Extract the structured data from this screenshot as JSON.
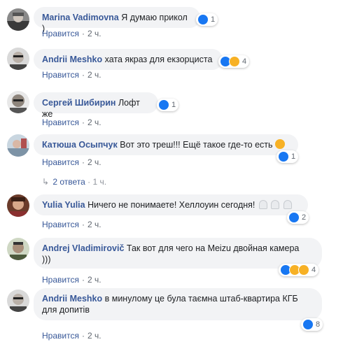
{
  "labels": {
    "like_action": "Нравится",
    "separator": "·"
  },
  "colors": {
    "author": "#385898",
    "bubble": "#f2f3f5",
    "like_reaction": "#1877f2",
    "haha_reaction": "#f7b125"
  },
  "comments": [
    {
      "author": "Marina Vadimovna",
      "text": "Я думаю прикол )",
      "text2": "",
      "reactions": [
        "like"
      ],
      "count": "1",
      "time": "2 ч."
    },
    {
      "author": "Andrii Meshko",
      "text": "хата якраз для екзорциста",
      "text2": "",
      "reactions": [
        "like",
        "haha"
      ],
      "count": "4",
      "time": "2 ч."
    },
    {
      "author": "Сергей Шибирин",
      "text": "Лофт же",
      "text2": "",
      "reactions": [
        "like"
      ],
      "count": "1",
      "time": "2 ч."
    },
    {
      "author": "Катюша Осыпчук",
      "text": "Вот это треш!!! Ещё такое где-то есть",
      "text2": "",
      "emoji": "weary-face-emoji",
      "reactions": [
        "like"
      ],
      "count": "1",
      "time": "2 ч."
    },
    {
      "author": "Yulia Yulia",
      "text": "Ничего не понимаете! Хеллоуин сегодня!",
      "text2": "",
      "emoji": "ghost-emoji",
      "reactions": [
        "like"
      ],
      "count": "2",
      "time": "2 ч."
    },
    {
      "author": "Andrej Vladimirovič",
      "text": "Так вот для чего на Meizu двойная камера",
      "text2": ")))",
      "reactions": [
        "like",
        "haha",
        "wow"
      ],
      "count": "4",
      "time": "2 ч."
    },
    {
      "author": "Andrii Meshko",
      "text": "в минулому це була таємна штаб-квартира КГБ",
      "text2": "для допитів",
      "reactions": [
        "like"
      ],
      "count": "8",
      "time": "2 ч."
    }
  ],
  "replies_thread": {
    "label": "2 ответа",
    "time": "1 ч.",
    "icon": "reply-arrow-icon"
  }
}
